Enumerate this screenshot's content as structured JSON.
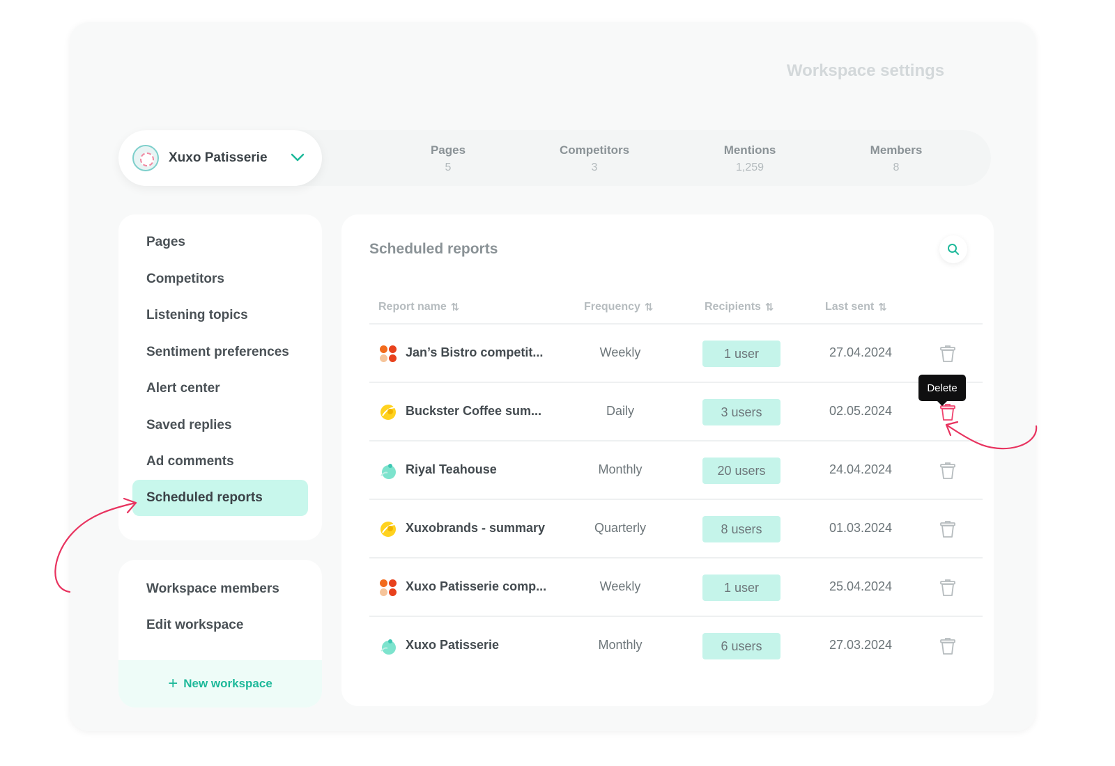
{
  "page_title": "Workspace settings",
  "workspace": {
    "name": "Xuxo Patisserie"
  },
  "stats": [
    {
      "label": "Pages",
      "value": "5"
    },
    {
      "label": "Competitors",
      "value": "3"
    },
    {
      "label": "Mentions",
      "value": "1,259"
    },
    {
      "label": "Members",
      "value": "8"
    }
  ],
  "sidebar": {
    "items": [
      {
        "label": "Pages"
      },
      {
        "label": "Competitors"
      },
      {
        "label": "Listening topics"
      },
      {
        "label": "Sentiment preferences"
      },
      {
        "label": "Alert center"
      },
      {
        "label": "Saved replies"
      },
      {
        "label": "Ad comments"
      },
      {
        "label": "Scheduled reports",
        "active": true
      }
    ],
    "secondary": [
      {
        "label": "Workspace members"
      },
      {
        "label": "Edit workspace"
      }
    ],
    "new_workspace": "New workspace"
  },
  "main": {
    "title": "Scheduled reports",
    "columns": {
      "report_name": "Report name",
      "frequency": "Frequency",
      "recipients": "Recipients",
      "last_sent": "Last sent"
    },
    "rows": [
      {
        "icon": "orange-logo",
        "name": "Jan’s Bistro competit...",
        "frequency": "Weekly",
        "recipients": "1 user",
        "last_sent": "27.04.2024"
      },
      {
        "icon": "yellow-logo",
        "name": "Buckster Coffee sum...",
        "frequency": "Daily",
        "recipients": "3 users",
        "last_sent": "02.05.2024",
        "hovered": true
      },
      {
        "icon": "teal-logo",
        "name": "Riyal Teahouse",
        "frequency": "Monthly",
        "recipients": "20 users",
        "last_sent": "24.04.2024"
      },
      {
        "icon": "yellow-logo",
        "name": "Xuxobrands - summary",
        "frequency": "Quarterly",
        "recipients": "8 users",
        "last_sent": "01.03.2024"
      },
      {
        "icon": "orange-logo",
        "name": "Xuxo Patisserie comp...",
        "frequency": "Weekly",
        "recipients": "1 user",
        "last_sent": "25.04.2024"
      },
      {
        "icon": "teal-logo",
        "name": "Xuxo Patisserie",
        "frequency": "Monthly",
        "recipients": "6 users",
        "last_sent": "27.03.2024"
      }
    ],
    "tooltip": "Delete"
  },
  "colors": {
    "accent": "#1eb99a",
    "active_bg": "#c8f7ec",
    "badge_bg": "#c5f4ea",
    "danger": "#f0436e",
    "annotation": "#e8335f"
  }
}
